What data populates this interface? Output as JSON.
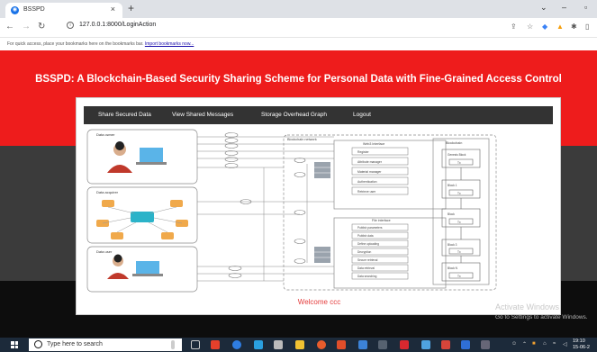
{
  "browser": {
    "tab_title": "BSSPD",
    "tab_close": "×",
    "new_tab": "+",
    "url": "127.0.0.1:8000/LoginAction",
    "bookmarks_text": "For quick access, place your bookmarks here on the bookmarks bar.",
    "bookmarks_link": "Import bookmarks now..."
  },
  "page": {
    "title": "BSSPD: A Blockchain-Based Security Sharing Scheme for Personal Data with Fine-Grained Access Control",
    "menu": [
      "Share Secured Data",
      "View Shared Messages",
      "Storage Overhead Graph",
      "Logout"
    ],
    "welcome": "Welcome ccc"
  },
  "diagram": {
    "left_panels": [
      "Data owner",
      "Data acquirer",
      "Data user"
    ],
    "center_title": "Blockchain network",
    "service_box": "Web3 Interface",
    "service_items": [
      "Register",
      "Attribute manager",
      "Material manager",
      "Authentication",
      "Retrieve user"
    ],
    "lower_title": "File interface",
    "lower_items": [
      "Publish parameters",
      "Publish data",
      "Define uploading",
      "Decryption",
      "Secure retrieval",
      "Data retrieval",
      "Data searching"
    ],
    "right_title": "Blockchain",
    "blocks": [
      "Genesis Block",
      "Block 1",
      "Block",
      "Block 3",
      "Block N"
    ],
    "block_inner": "Tx"
  },
  "windows": {
    "activate_title": "Activate Windows",
    "activate_sub": "Go to Settings to activate Windows.",
    "search_placeholder": "Type here to search",
    "time": "19:10",
    "date": "15-06-2"
  },
  "colors": {
    "red_band": "#ee1c1c",
    "menu_bg": "#333333",
    "welcome_text": "#e43c3c"
  }
}
